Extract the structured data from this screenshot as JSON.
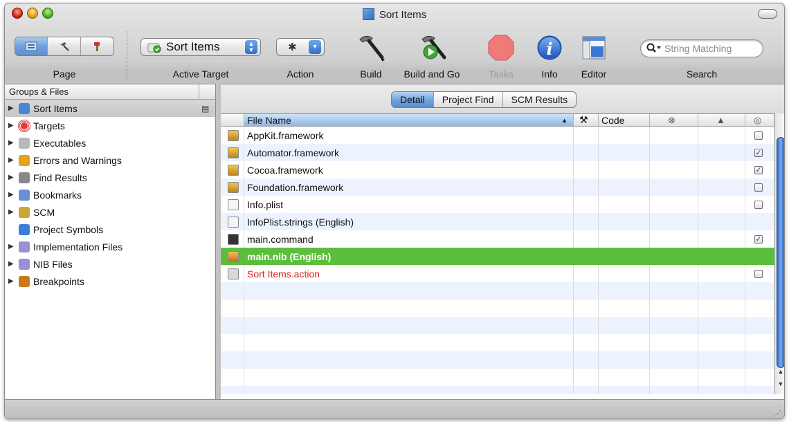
{
  "window": {
    "title": "Sort Items"
  },
  "toolbar": {
    "page_label": "Page",
    "active_target_label": "Active Target",
    "active_target_value": "Sort Items",
    "action_label": "Action",
    "build_label": "Build",
    "build_and_go_label": "Build and Go",
    "tasks_label": "Tasks",
    "info_label": "Info",
    "editor_label": "Editor",
    "search_label": "Search",
    "search_placeholder": "String Matching"
  },
  "sidebar": {
    "header": "Groups & Files",
    "items": [
      {
        "label": "Sort Items",
        "icon": "project-icon",
        "color": "#4a86d8"
      },
      {
        "label": "Targets",
        "icon": "target-icon",
        "color": "#e03a3a"
      },
      {
        "label": "Executables",
        "icon": "executable-icon",
        "color": "#b9b9b9"
      },
      {
        "label": "Errors and Warnings",
        "icon": "warning-icon",
        "color": "#e8a21a"
      },
      {
        "label": "Find Results",
        "icon": "magnifier-icon",
        "color": "#888888"
      },
      {
        "label": "Bookmarks",
        "icon": "bookmark-icon",
        "color": "#6a8fd8"
      },
      {
        "label": "SCM",
        "icon": "scm-icon",
        "color": "#c9a83a"
      },
      {
        "label": "Project Symbols",
        "icon": "symbols-icon",
        "color": "#3b7fd6"
      },
      {
        "label": "Implementation Files",
        "icon": "smart-folder-icon",
        "color": "#9b8fd6"
      },
      {
        "label": "NIB Files",
        "icon": "smart-folder-icon",
        "color": "#9b8fd6"
      },
      {
        "label": "Breakpoints",
        "icon": "breakpoint-icon",
        "color": "#c87a1a"
      }
    ]
  },
  "main": {
    "tabs": [
      "Detail",
      "Project Find",
      "SCM Results"
    ],
    "columns": {
      "file_name": "File Name",
      "code": "Code"
    },
    "rows": [
      {
        "name": "AppKit.framework",
        "icon": "framework-icon",
        "checked": false,
        "has_checkbox": true
      },
      {
        "name": "Automator.framework",
        "icon": "framework-icon",
        "checked": true,
        "has_checkbox": true
      },
      {
        "name": "Cocoa.framework",
        "icon": "framework-icon",
        "checked": true,
        "has_checkbox": true
      },
      {
        "name": "Foundation.framework",
        "icon": "framework-icon",
        "checked": false,
        "has_checkbox": true
      },
      {
        "name": "Info.plist",
        "icon": "plist-icon",
        "checked": false,
        "has_checkbox": true
      },
      {
        "name": "InfoPlist.strings (English)",
        "icon": "strings-icon",
        "checked": false,
        "has_checkbox": false
      },
      {
        "name": "main.command",
        "icon": "command-icon",
        "checked": true,
        "has_checkbox": true
      },
      {
        "name": "main.nib (English)",
        "icon": "nib-icon",
        "checked": false,
        "has_checkbox": false,
        "selected": true
      },
      {
        "name": "Sort Items.action",
        "icon": "action-bundle-icon",
        "checked": false,
        "has_checkbox": true,
        "missing": true
      }
    ],
    "empty_rows": 7
  }
}
